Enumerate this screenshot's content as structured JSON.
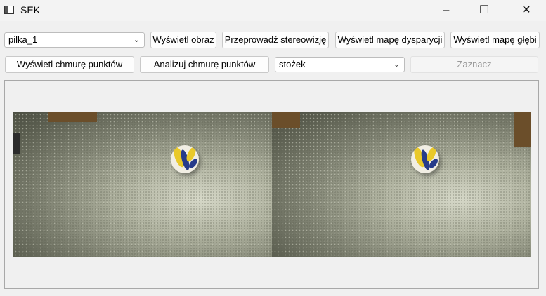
{
  "window": {
    "title": "SEK",
    "minimize_glyph": "–",
    "maximize_glyph": "☐",
    "close_glyph": "✕"
  },
  "toolbar": {
    "object_select": {
      "value": "pilka_1"
    },
    "show_image_label": "Wyświetl obraz",
    "stereovision_label": "Przeprowadź stereowizję",
    "disparity_map_label": "Wyświetl mapę dysparycji",
    "depth_map_label": "Wyświetl mapę głębi",
    "show_point_cloud_label": "Wyświetl chmurę punktów",
    "analyze_point_cloud_label": "Analizuj chmurę punktów",
    "shape_select": {
      "value": "stożek"
    },
    "mark_label": "Zaznacz",
    "mark_enabled": false
  },
  "icons": {
    "dropdown": "chevron-down-icon",
    "app": "app-window-icon"
  },
  "colors": {
    "floor": "#a9ac99",
    "ball_yellow": "#e9c92a",
    "ball_blue": "#263b8a",
    "box": "#6b4e2a"
  }
}
